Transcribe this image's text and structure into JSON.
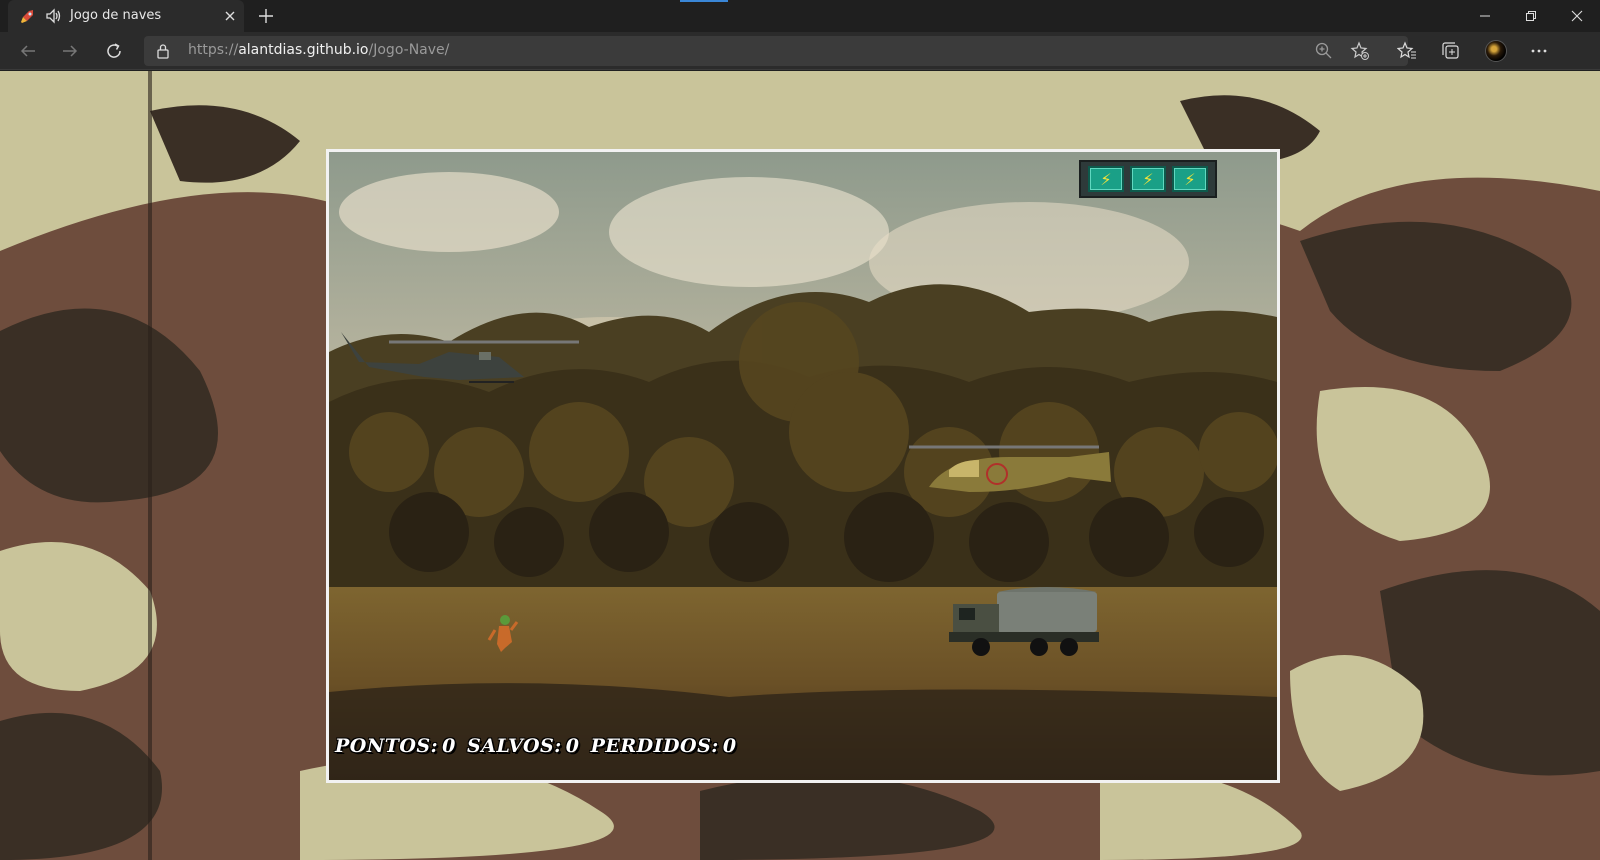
{
  "browser": {
    "tab_title": "Jogo de naves",
    "url_prefix": "https://",
    "url_host": "alantdias.github.io",
    "url_path": "/Jogo-Nave/"
  },
  "icons": {
    "tab_favicon": "rocket-icon",
    "tab_audio": "speaker-icon",
    "tab_close": "close-icon",
    "new_tab": "plus-icon",
    "back": "arrow-left-icon",
    "forward": "arrow-right-icon",
    "reload": "reload-icon",
    "lock": "lock-icon",
    "zoom": "zoom-icon",
    "add_favorite": "star-plus-icon",
    "favorites": "favorites-icon",
    "collections": "collections-icon",
    "profile": "avatar",
    "menu": "more-icon",
    "minimize": "minimize-icon",
    "restore": "restore-icon",
    "close_window": "close-window-icon"
  },
  "game": {
    "energy_cells": [
      "⚡",
      "⚡",
      "⚡"
    ],
    "score": {
      "pontos_label": "PONTOS:",
      "pontos_value": "0",
      "salvos_label": "SALVOS:",
      "salvos_value": "0",
      "perdidos_label": "PERDIDOS:",
      "perdidos_value": "0"
    },
    "sprites": [
      "player-helicopter",
      "enemy-helicopter",
      "army-truck",
      "friend-soldier"
    ]
  },
  "colors": {
    "camo_light": "#c9c49a",
    "camo_dark": "#3a2f25",
    "camo_brown": "#6d4a3a",
    "energy_cell": "#1aa087"
  }
}
